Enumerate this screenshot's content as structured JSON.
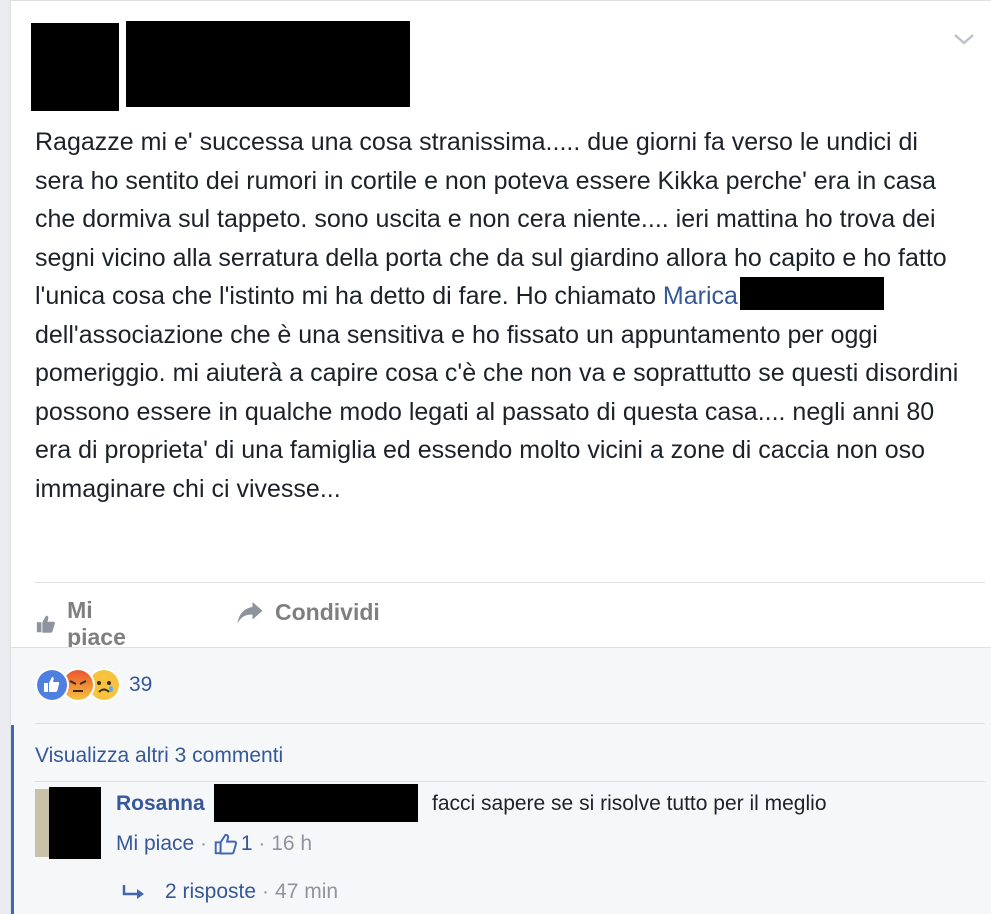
{
  "post": {
    "text_before_link": "Ragazze mi e' successa una cosa stranissima..... due giorni fa verso le undici di sera ho sentito dei rumori in cortile e non poteva essere Kikka perche' era in casa che dormiva sul tappeto. sono uscita e non cera niente.... ieri mattina ho trova dei segni vicino alla serratura della porta che da sul giardino allora ho capito e ho fatto l'unica cosa che l'istinto mi ha detto di fare. Ho chiamato ",
    "mention": "Marica",
    "text_after_link": "dell'associazione che è una sensitiva e ho fissato un appuntamento per oggi pomeriggio. mi aiuterà a capire cosa c'è che non va e soprattutto se questi disordini possono essere in qualche modo legati al passato di questa casa.... negli anni 80 era di proprieta' di una famiglia ed essendo molto vicini a zone di caccia non oso immaginare chi ci vivesse..."
  },
  "actions": {
    "like_label": "Mi piace",
    "share_label": "Condividi"
  },
  "reactions": {
    "count": "39",
    "icons": [
      "like-icon",
      "angry-icon",
      "sad-icon"
    ]
  },
  "comments": {
    "view_more": "Visualizza altri 3 commenti",
    "items": [
      {
        "author": "Rosanna",
        "text": "facci sapere se si risolve tutto per il meglio",
        "like_label": "Mi piace",
        "like_count": "1",
        "time": "16 h",
        "replies_label": "2 risposte",
        "replies_time": "47 min"
      }
    ]
  },
  "colors": {
    "link": "#365899",
    "text": "#1d2129",
    "muted": "#90949c"
  }
}
